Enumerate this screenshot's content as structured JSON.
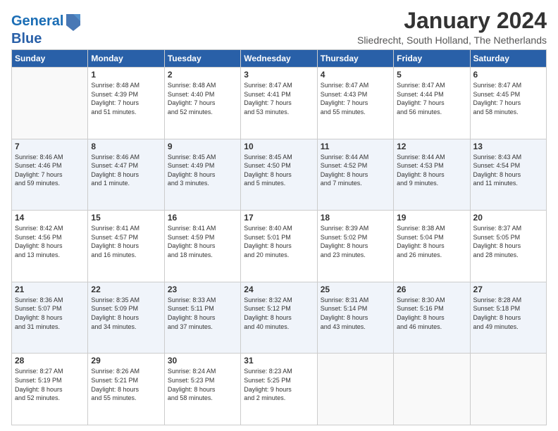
{
  "header": {
    "logo_line1": "General",
    "logo_line2": "Blue",
    "title": "January 2024",
    "subtitle": "Sliedrecht, South Holland, The Netherlands"
  },
  "calendar": {
    "headers": [
      "Sunday",
      "Monday",
      "Tuesday",
      "Wednesday",
      "Thursday",
      "Friday",
      "Saturday"
    ],
    "weeks": [
      [
        {
          "day": "",
          "info": ""
        },
        {
          "day": "1",
          "info": "Sunrise: 8:48 AM\nSunset: 4:39 PM\nDaylight: 7 hours\nand 51 minutes."
        },
        {
          "day": "2",
          "info": "Sunrise: 8:48 AM\nSunset: 4:40 PM\nDaylight: 7 hours\nand 52 minutes."
        },
        {
          "day": "3",
          "info": "Sunrise: 8:47 AM\nSunset: 4:41 PM\nDaylight: 7 hours\nand 53 minutes."
        },
        {
          "day": "4",
          "info": "Sunrise: 8:47 AM\nSunset: 4:43 PM\nDaylight: 7 hours\nand 55 minutes."
        },
        {
          "day": "5",
          "info": "Sunrise: 8:47 AM\nSunset: 4:44 PM\nDaylight: 7 hours\nand 56 minutes."
        },
        {
          "day": "6",
          "info": "Sunrise: 8:47 AM\nSunset: 4:45 PM\nDaylight: 7 hours\nand 58 minutes."
        }
      ],
      [
        {
          "day": "7",
          "info": "Sunrise: 8:46 AM\nSunset: 4:46 PM\nDaylight: 7 hours\nand 59 minutes."
        },
        {
          "day": "8",
          "info": "Sunrise: 8:46 AM\nSunset: 4:47 PM\nDaylight: 8 hours\nand 1 minute."
        },
        {
          "day": "9",
          "info": "Sunrise: 8:45 AM\nSunset: 4:49 PM\nDaylight: 8 hours\nand 3 minutes."
        },
        {
          "day": "10",
          "info": "Sunrise: 8:45 AM\nSunset: 4:50 PM\nDaylight: 8 hours\nand 5 minutes."
        },
        {
          "day": "11",
          "info": "Sunrise: 8:44 AM\nSunset: 4:52 PM\nDaylight: 8 hours\nand 7 minutes."
        },
        {
          "day": "12",
          "info": "Sunrise: 8:44 AM\nSunset: 4:53 PM\nDaylight: 8 hours\nand 9 minutes."
        },
        {
          "day": "13",
          "info": "Sunrise: 8:43 AM\nSunset: 4:54 PM\nDaylight: 8 hours\nand 11 minutes."
        }
      ],
      [
        {
          "day": "14",
          "info": "Sunrise: 8:42 AM\nSunset: 4:56 PM\nDaylight: 8 hours\nand 13 minutes."
        },
        {
          "day": "15",
          "info": "Sunrise: 8:41 AM\nSunset: 4:57 PM\nDaylight: 8 hours\nand 16 minutes."
        },
        {
          "day": "16",
          "info": "Sunrise: 8:41 AM\nSunset: 4:59 PM\nDaylight: 8 hours\nand 18 minutes."
        },
        {
          "day": "17",
          "info": "Sunrise: 8:40 AM\nSunset: 5:01 PM\nDaylight: 8 hours\nand 20 minutes."
        },
        {
          "day": "18",
          "info": "Sunrise: 8:39 AM\nSunset: 5:02 PM\nDaylight: 8 hours\nand 23 minutes."
        },
        {
          "day": "19",
          "info": "Sunrise: 8:38 AM\nSunset: 5:04 PM\nDaylight: 8 hours\nand 26 minutes."
        },
        {
          "day": "20",
          "info": "Sunrise: 8:37 AM\nSunset: 5:05 PM\nDaylight: 8 hours\nand 28 minutes."
        }
      ],
      [
        {
          "day": "21",
          "info": "Sunrise: 8:36 AM\nSunset: 5:07 PM\nDaylight: 8 hours\nand 31 minutes."
        },
        {
          "day": "22",
          "info": "Sunrise: 8:35 AM\nSunset: 5:09 PM\nDaylight: 8 hours\nand 34 minutes."
        },
        {
          "day": "23",
          "info": "Sunrise: 8:33 AM\nSunset: 5:11 PM\nDaylight: 8 hours\nand 37 minutes."
        },
        {
          "day": "24",
          "info": "Sunrise: 8:32 AM\nSunset: 5:12 PM\nDaylight: 8 hours\nand 40 minutes."
        },
        {
          "day": "25",
          "info": "Sunrise: 8:31 AM\nSunset: 5:14 PM\nDaylight: 8 hours\nand 43 minutes."
        },
        {
          "day": "26",
          "info": "Sunrise: 8:30 AM\nSunset: 5:16 PM\nDaylight: 8 hours\nand 46 minutes."
        },
        {
          "day": "27",
          "info": "Sunrise: 8:28 AM\nSunset: 5:18 PM\nDaylight: 8 hours\nand 49 minutes."
        }
      ],
      [
        {
          "day": "28",
          "info": "Sunrise: 8:27 AM\nSunset: 5:19 PM\nDaylight: 8 hours\nand 52 minutes."
        },
        {
          "day": "29",
          "info": "Sunrise: 8:26 AM\nSunset: 5:21 PM\nDaylight: 8 hours\nand 55 minutes."
        },
        {
          "day": "30",
          "info": "Sunrise: 8:24 AM\nSunset: 5:23 PM\nDaylight: 8 hours\nand 58 minutes."
        },
        {
          "day": "31",
          "info": "Sunrise: 8:23 AM\nSunset: 5:25 PM\nDaylight: 9 hours\nand 2 minutes."
        },
        {
          "day": "",
          "info": ""
        },
        {
          "day": "",
          "info": ""
        },
        {
          "day": "",
          "info": ""
        }
      ]
    ]
  }
}
